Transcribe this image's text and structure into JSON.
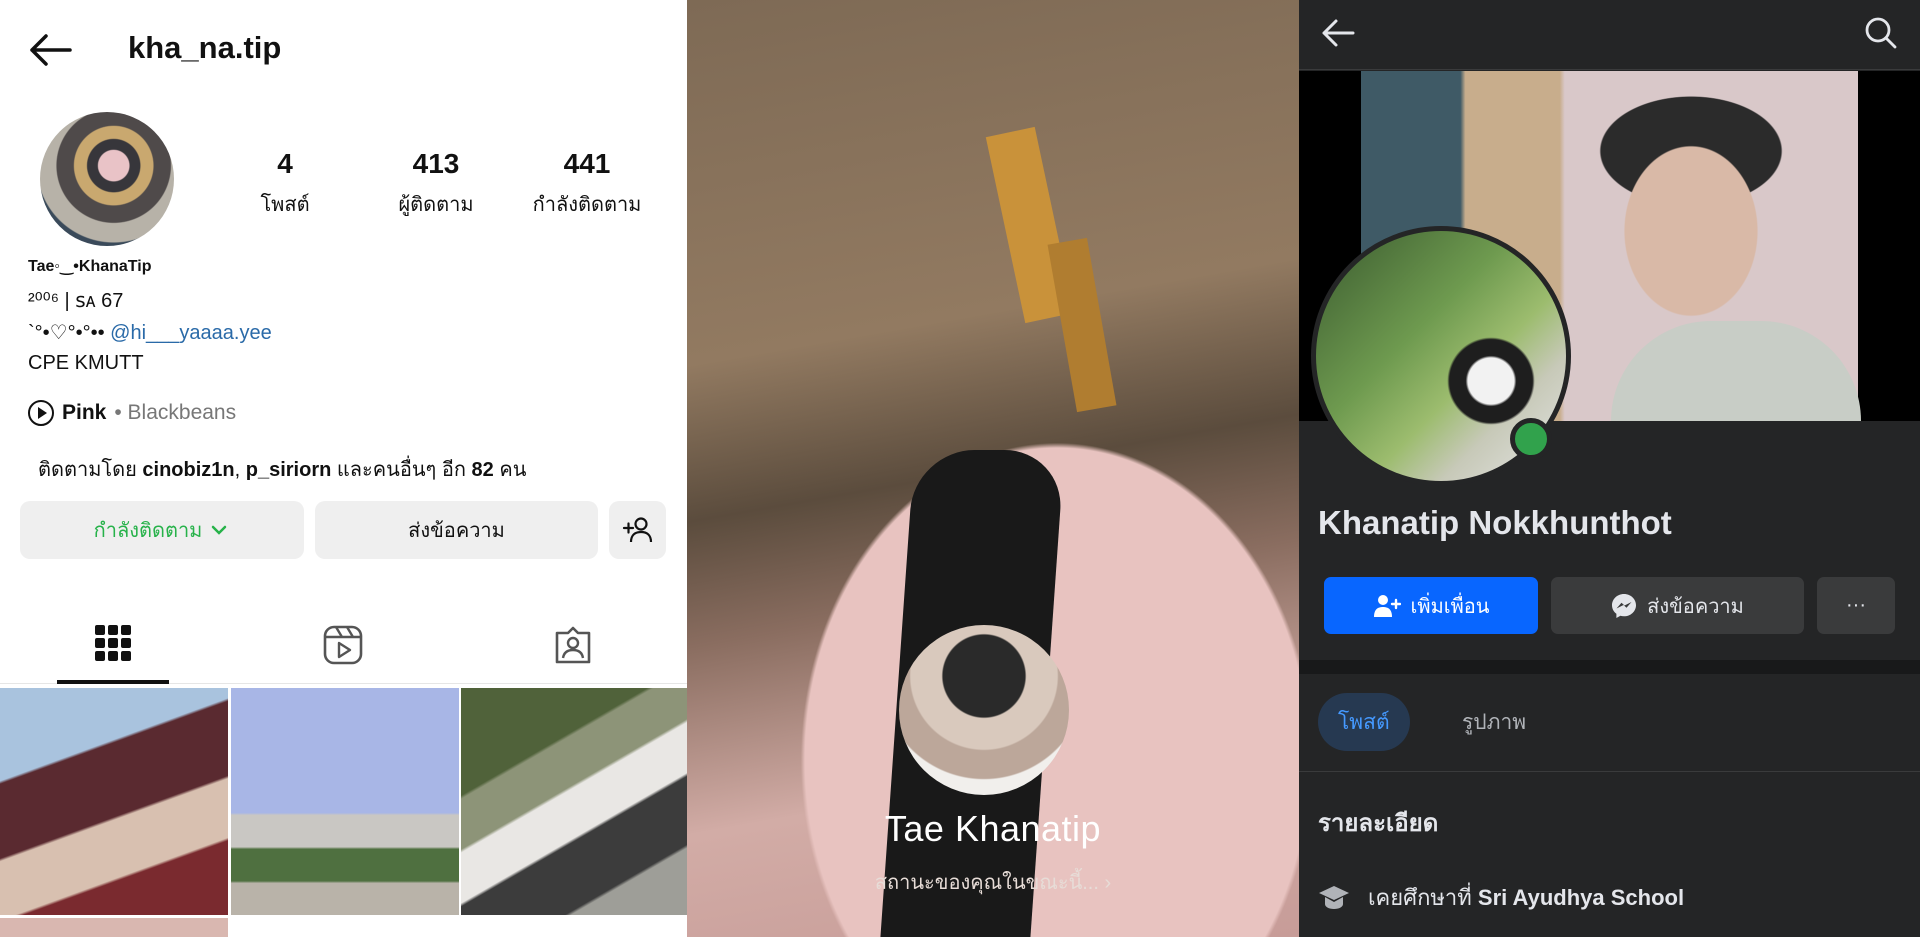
{
  "instagram": {
    "username": "kha_na.tip",
    "stats": [
      {
        "value": "4",
        "label": "โพสต์"
      },
      {
        "value": "413",
        "label": "ผู้ติดตาม"
      },
      {
        "value": "441",
        "label": "กำลังติดตาม"
      }
    ],
    "display_name": "Tae◦‿•KhanaTip",
    "bio_line1": "²⁰⁰⁶ | ꜱᴀ 67",
    "bio_line2_prefix": "`°•♡°•°••",
    "bio_mention": "@hi___yaaaa.yee",
    "bio_line3": "CPE KMUTT",
    "music_song": "Pink",
    "music_artist": "• Blackbeans",
    "followed_by_prefix": "ติดตามโดย",
    "followed_by_user1": "cinobiz1n",
    "followed_by_comma": ",",
    "followed_by_user2": "p_siriorn",
    "followed_by_suffix": "และคนอื่นๆ อีก",
    "followed_by_count": "82",
    "followed_by_unit": "คน",
    "following_button": "กำลังติดตาม",
    "message_button": "ส่งข้อความ",
    "accent_green": "#27b24a",
    "icons": [
      "back-arrow-icon",
      "grid-icon",
      "reels-icon",
      "tagged-icon",
      "add-user-icon",
      "play-icon",
      "chevron-down-icon"
    ]
  },
  "story": {
    "name": "Tae Khanatip",
    "status": "สถานะของคุณในขณะนี้..."
  },
  "facebook": {
    "name": "Khanatip Nokkhunthot",
    "add_friend_button": "เพิ่มเพื่อน",
    "message_button": "ส่งข้อความ",
    "more_button": "···",
    "tabs": [
      {
        "label": "โพสต์",
        "active": true
      },
      {
        "label": "รูปภาพ",
        "active": false
      }
    ],
    "section_title": "รายละเอียด",
    "education_prefix": "เคยศึกษาที่",
    "education_school": "Sri Ayudhya School",
    "accent_blue": "#0866ff",
    "online_color": "#31a24c",
    "icons": [
      "back-arrow-icon",
      "search-icon",
      "add-friend-icon",
      "messenger-icon",
      "education-icon"
    ]
  }
}
